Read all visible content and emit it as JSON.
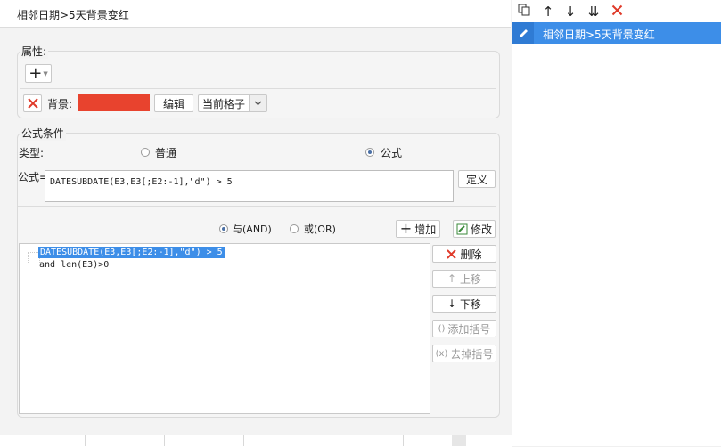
{
  "dialog": {
    "title": "相邻日期>5天背景变红",
    "properties": {
      "group_label": "属性:",
      "add_label": "+",
      "bg_label": "背景:",
      "bg_color": "#e8432e",
      "edit_button": "编辑",
      "scope_select": "当前格子"
    },
    "formula_condition": {
      "group_label": "公式条件",
      "type_label": "类型:",
      "type_normal": "普通",
      "type_formula": "公式",
      "formula_label": "公式=",
      "formula_value": "DATESUBDATE(E3,E3[;E2:-1],\"d\") > 5",
      "define_button": "定义",
      "and_label": "与(AND)",
      "or_label": "或(OR)",
      "add_button": "增加",
      "modify_button": "修改",
      "conditions": [
        "DATESUBDATE(E3,E3[;E2:-1],\"d\") > 5",
        "and len(E3)>0"
      ],
      "delete_button": "删除",
      "move_up_button": "上移",
      "move_down_button": "下移",
      "add_bracket_button": "添加括号",
      "remove_bracket_button": "去掉括号"
    }
  },
  "right_panel": {
    "toolbar_icons": [
      "copy-icon",
      "arrow-up-icon",
      "arrow-down-icon",
      "move-bottom-icon",
      "delete-icon"
    ],
    "items": [
      {
        "label": "相邻日期>5天背景变红",
        "selected": true
      }
    ]
  }
}
